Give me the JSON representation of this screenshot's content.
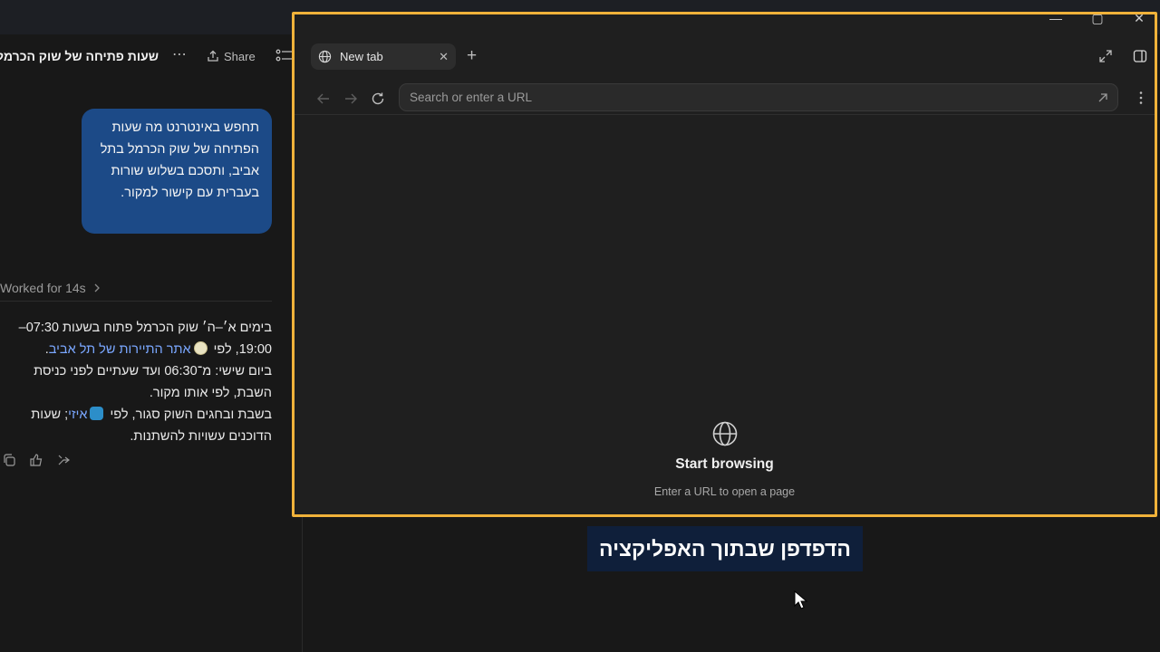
{
  "chat": {
    "title": "שעות פתיחה של שוק הכרמל",
    "share_label": "Share",
    "user_message": "תחפש באינטרנט מה שעות הפתיחה של שוק הכרמל בתל אביב, ותסכם בשלוש שורות בעברית עם קישור למקור.",
    "worked_label": "Worked for 14s",
    "answer": {
      "line1_a": "בימים א׳–ה׳ שוק הכרמל פתוח בשעות 07:30–",
      "line1_b": "19:00, לפי",
      "link1": "אתר התיירות של תל אביב",
      "line1_end": ".",
      "line2": "ביום שישי: מ־06:30 ועד שעתיים לפני כניסת השבת, לפי אותו מקור.",
      "line3_a": "בשבת ובחגים השוק סגור, לפי",
      "link2": "איזי",
      "line3_b": "; שעות הדוכנים עשויות להשתנות."
    }
  },
  "browser": {
    "tab_label": "New tab",
    "url_placeholder": "Search or enter a URL",
    "url_value": "",
    "empty_title": "Start browsing",
    "empty_subtitle": "Enter a URL to open a page"
  },
  "caption": "הדפדפן שבתוך האפליקציה",
  "colors": {
    "highlight_border": "#f0b23a",
    "user_bubble": "#1c4a87",
    "link": "#7aa7ff",
    "caption_bg": "#0f1f3a"
  }
}
